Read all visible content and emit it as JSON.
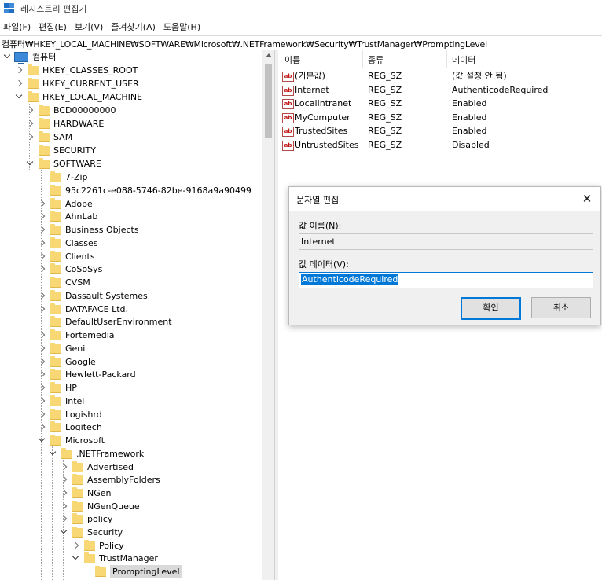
{
  "window": {
    "title": "레지스트리 편집기",
    "icon": "registry-editor-icon"
  },
  "menu": [
    "파일(F)",
    "편집(E)",
    "보기(V)",
    "즐겨찾기(A)",
    "도움말(H)"
  ],
  "address": "컴퓨터₩HKEY_LOCAL_MACHINE₩SOFTWARE₩Microsoft₩.NETFramework₩Security₩TrustManager₩PromptingLevel",
  "tree": {
    "root": "컴퓨터",
    "hives": [
      "HKEY_CLASSES_ROOT",
      "HKEY_CURRENT_USER",
      "HKEY_LOCAL_MACHINE"
    ],
    "hklm_children": [
      "BCD00000000",
      "HARDWARE",
      "SAM",
      "SECURITY",
      "SOFTWARE"
    ],
    "software_children": [
      "7-Zip",
      "95c2261c-e088-5746-82be-9168a9a90499",
      "Adobe",
      "AhnLab",
      "Business Objects",
      "Classes",
      "Clients",
      "CoSoSys",
      "CVSM",
      "Dassault Systemes",
      "DATAFACE Ltd.",
      "DefaultUserEnvironment",
      "Fortemedia",
      "Geni",
      "Google",
      "Hewlett-Packard",
      "HP",
      "Intel",
      "Logishrd",
      "Logitech",
      "Microsoft"
    ],
    "microsoft_children": [
      ".NETFramework"
    ],
    "netframework_children": [
      "Advertised",
      "AssemblyFolders",
      "NGen",
      "NGenQueue",
      "policy",
      "Security"
    ],
    "security_children": [
      "Policy",
      "TrustManager"
    ],
    "trustmanager_children": [
      "PromptingLevel"
    ]
  },
  "list": {
    "columns": [
      "이름",
      "종류",
      "데이터"
    ],
    "rows": [
      {
        "name": "(기본값)",
        "type": "REG_SZ",
        "data": "(값 설정 안 됨)"
      },
      {
        "name": "Internet",
        "type": "REG_SZ",
        "data": "AuthenticodeRequired"
      },
      {
        "name": "LocalIntranet",
        "type": "REG_SZ",
        "data": "Enabled"
      },
      {
        "name": "MyComputer",
        "type": "REG_SZ",
        "data": "Enabled"
      },
      {
        "name": "TrustedSites",
        "type": "REG_SZ",
        "data": "Enabled"
      },
      {
        "name": "UntrustedSites",
        "type": "REG_SZ",
        "data": "Disabled"
      }
    ]
  },
  "dialog": {
    "title": "문자열 편집",
    "close": "✕",
    "name_label": "값 이름(N):",
    "name_value": "Internet",
    "data_label": "값 데이터(V):",
    "data_value": "AuthenticodeRequired",
    "ok": "확인",
    "cancel": "취소"
  }
}
